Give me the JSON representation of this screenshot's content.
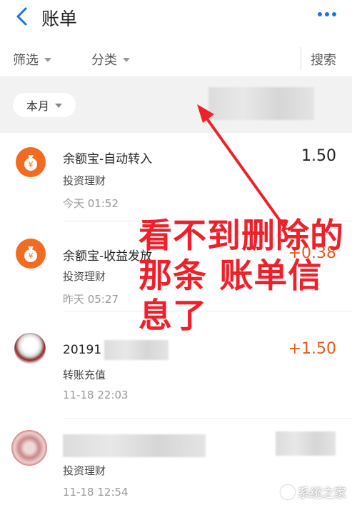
{
  "header": {
    "title": "账单"
  },
  "filters": {
    "filter_label": "筛选",
    "category_label": "分类",
    "search_label": "搜索"
  },
  "month": {
    "label": "本月"
  },
  "transactions": [
    {
      "title": "余额宝-自动转入",
      "category": "投资理财",
      "time": "今天  01:52",
      "amount": "1.50",
      "icon": "yuebao-coin-bag-icon"
    },
    {
      "title": "余额宝-收益发放",
      "category": "投资理财",
      "time": "昨天  05:27",
      "amount": "+0.38",
      "icon": "yuebao-coin-bag-icon"
    },
    {
      "title": "20191",
      "category": "转账充值",
      "time": "11-18  22:03",
      "amount": "+1.50",
      "icon": "blurred-avatar-icon"
    },
    {
      "title": "",
      "category": "投资理财",
      "time": "11-18  12:54",
      "amount": "",
      "icon": "blurred-avatar-icon"
    }
  ],
  "annotation": {
    "line1": "看不到删除的",
    "line2": "那条 账单信",
    "line3": "息了"
  },
  "watermark": {
    "text": "系统之家"
  },
  "colors": {
    "accent_blue": "#1a73e8",
    "icon_orange": "#f26b21",
    "positive_amount": "#e85a1c",
    "annotation_red": "#f0202a"
  }
}
